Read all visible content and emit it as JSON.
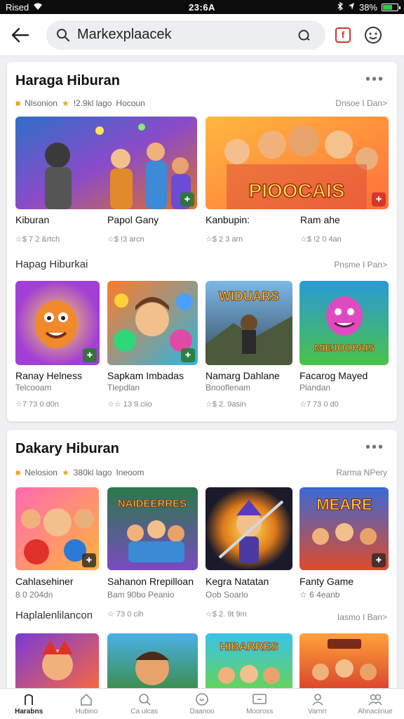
{
  "status": {
    "carrier": "Rised",
    "time": "23:6A",
    "battery": "38%"
  },
  "search": {
    "query": "Markexplaacek"
  },
  "section1": {
    "title": "Haraga Hiburan",
    "more": "•••",
    "meta": [
      "Nlsonion",
      "!2.9kl lago",
      "Hocoun"
    ],
    "link": "Dnsoe I Dan>",
    "featured": [
      {
        "name": "Kiburan",
        "rating": "☆$ 7 2 &rtch"
      },
      {
        "name": "Papol Gany",
        "rating": "☆$ !3 arcn"
      },
      {
        "name": "Kanbupin:",
        "rating": "☆$ 2 3 arn"
      },
      {
        "name": "Ram ahe",
        "rating": "☆$ !2 0 4an"
      }
    ],
    "featured_banner_text": "PIOOCAIS",
    "subhead": "Hapag Hiburkai",
    "sublink": "Pnsme I Pan>",
    "games": [
      {
        "name": "Ranay Helness",
        "dev": "Telcooam",
        "rating": "☆7 73 0 d0n"
      },
      {
        "name": "Sapkam Imbadas",
        "dev": "Tlepdlan",
        "rating": "☆☆ 13 9.ciio"
      },
      {
        "name": "Namarg Dahlane",
        "dev": "Bnooflenam",
        "rating": "☆$ 2. 9asin"
      },
      {
        "name": "Facarog Mayed",
        "dev": "Plandan",
        "rating": "☆7 73 0 d0"
      }
    ],
    "game_banner_texts": [
      "WIDUARS",
      "MIEJOOPAIS"
    ]
  },
  "section2": {
    "title": "Dakary Hiburan",
    "more": "•••",
    "meta": [
      "Nelosion",
      "380kl lago",
      "Ineoom"
    ],
    "link": "Rarma NPery",
    "games": [
      {
        "name": "Cahlasehiner",
        "dev": "8 0 204dn"
      },
      {
        "name": "Sahanon Rrepilloan",
        "dev": "Bam 90bo Peanio"
      },
      {
        "name": "Kegra Natatan",
        "dev": "Oob Soarlo"
      },
      {
        "name": "Fanty Game",
        "dev": "☆ 6 4eanb"
      }
    ],
    "banner_texts": [
      "NAIDEERRES",
      "MEARE"
    ],
    "subhead": "Haplalenlilancon",
    "ratings": [
      "☆ 73 0 cih",
      "☆$ 2. 9t 9m"
    ],
    "sublink": "Iasmo I Ban>",
    "row2_banner": "HIBARRES"
  },
  "nav": [
    {
      "label": "Harabns",
      "icon": "home-icon",
      "active": true
    },
    {
      "label": "Hubino",
      "icon": "house-icon",
      "active": false
    },
    {
      "label": "Ca ulcas",
      "icon": "search-icon",
      "active": false
    },
    {
      "label": "Daanoo",
      "icon": "clock-icon",
      "active": false
    },
    {
      "label": "Mooross",
      "icon": "tv-icon",
      "active": false
    },
    {
      "label": "Varnrr",
      "icon": "person-icon",
      "active": false
    },
    {
      "label": "Ahnaciinue",
      "icon": "people-icon",
      "active": false
    }
  ]
}
